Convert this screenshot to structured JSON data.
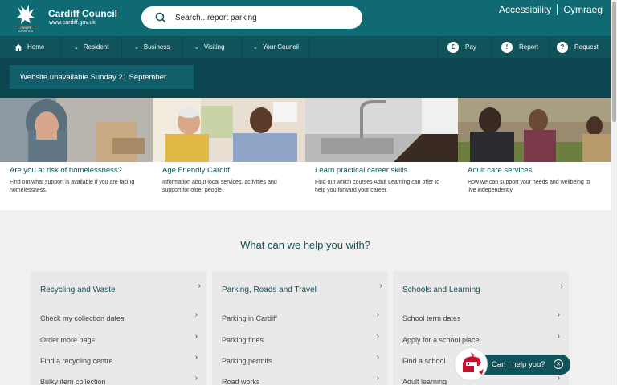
{
  "brand": {
    "name": "Cardiff Council",
    "url": "www.cardiff.gov.uk",
    "logo_text": "CARDIFF CAERDYDD"
  },
  "search": {
    "placeholder": "Search.. report parking"
  },
  "lang": {
    "accessibility": "Accessibility",
    "cymraeg": "Cymraeg"
  },
  "nav": {
    "home": "Home",
    "resident": "Resident",
    "business": "Business",
    "visiting": "Visiting",
    "council": "Your Council",
    "pay": "Pay",
    "report": "Report",
    "request": "Request",
    "pay_symbol": "£",
    "report_symbol": "!",
    "request_symbol": "?"
  },
  "alert": {
    "text": "Website unavailable Sunday 21 September"
  },
  "features": [
    {
      "title": "Are you at risk of homelessness?",
      "desc": "Find out what support is available if you are facing homelessness."
    },
    {
      "title": "Age Friendly Cardiff",
      "desc": "Information about local services, activities and support for older people."
    },
    {
      "title": "Learn practical career skills",
      "desc": "Find out which courses Adult Learning can offer to help you forward your career."
    },
    {
      "title": "Adult care services",
      "desc": "How we can support your needs and wellbeing to live independently."
    }
  ],
  "help_title": "What can we help you with?",
  "cards": [
    {
      "title": "Recycling and Waste",
      "links": [
        "Check my collection dates",
        "Order more bags",
        "Find a recycling centre",
        "Bulky item collection"
      ]
    },
    {
      "title": "Parking, Roads and Travel",
      "links": [
        "Parking in Cardiff",
        "Parking fines",
        "Parking permits",
        "Road works"
      ]
    },
    {
      "title": "Schools and Learning",
      "links": [
        "School term dates",
        "Apply for a school place",
        "Find a school",
        "Adult learning"
      ]
    }
  ],
  "chat": {
    "label": "Can I help you?"
  },
  "colors": {
    "primary": "#0f6a73",
    "nav": "#10535a",
    "alert_band": "#0b4550",
    "card_bg": "#e9e9e9"
  }
}
